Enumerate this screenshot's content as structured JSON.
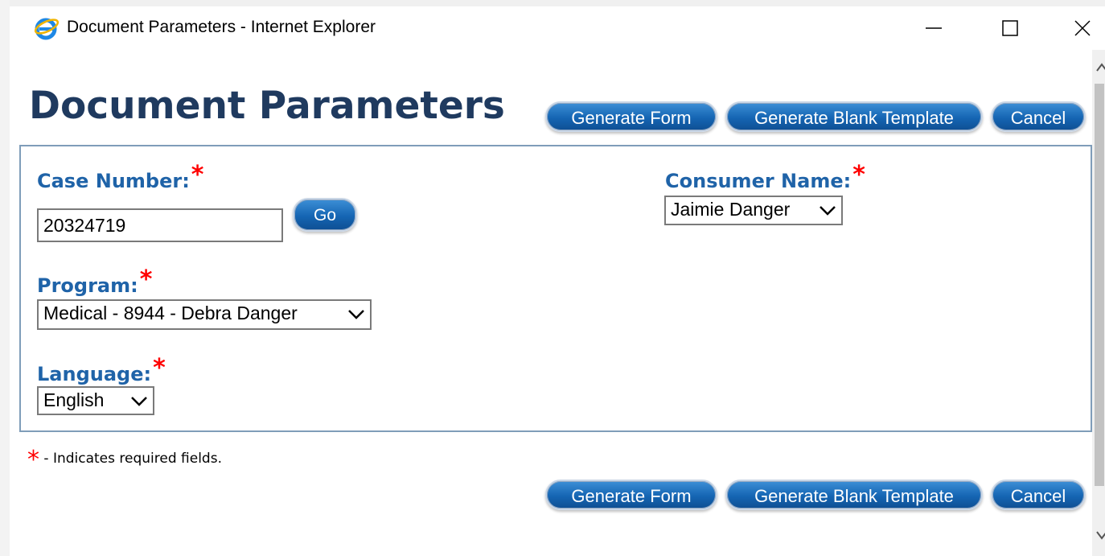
{
  "window": {
    "title": "Document Parameters - Internet Explorer",
    "icon": "ie-icon",
    "controls": [
      "minimize-icon",
      "maximize-icon",
      "close-icon"
    ]
  },
  "page": {
    "title": "Document Parameters"
  },
  "toolbar": {
    "generate_form": "Generate Form",
    "generate_blank_template": "Generate Blank Template",
    "cancel": "Cancel"
  },
  "form": {
    "case_number": {
      "label": "Case Number:",
      "required_mark": "*",
      "value": "20324719",
      "go_label": "Go"
    },
    "consumer_name": {
      "label": "Consumer Name:",
      "required_mark": "*",
      "selected": "Jaimie Danger"
    },
    "program": {
      "label": "Program:",
      "required_mark": "*",
      "selected": "Medical - 8944 - Debra Danger"
    },
    "language": {
      "label": "Language:",
      "required_mark": "*",
      "selected": "English"
    }
  },
  "footer_note": {
    "mark": "*",
    "text": "- Indicates required fields."
  },
  "colors": {
    "title": "#1f3a5f",
    "label": "#1f63a8",
    "required": "#ff0000",
    "button": "#1565b3",
    "panel_border": "#7f9db9"
  }
}
